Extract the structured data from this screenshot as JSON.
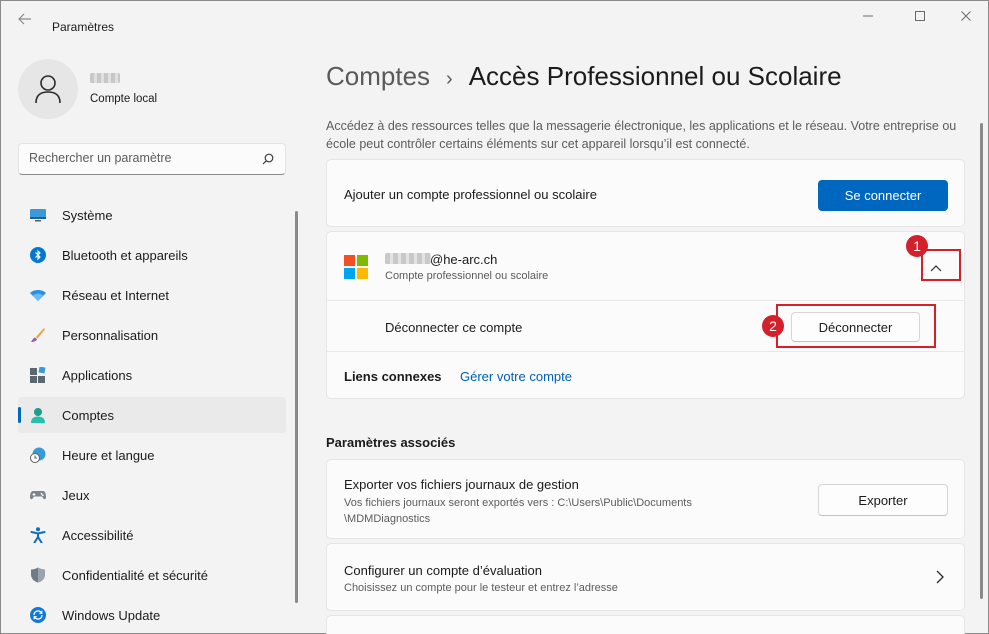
{
  "window": {
    "title": "Paramètres",
    "back_icon": "arrow-left-icon",
    "controls": [
      "minimize-icon",
      "maximize-icon",
      "close-icon"
    ]
  },
  "user": {
    "account_type": "Compte local"
  },
  "search": {
    "placeholder": "Rechercher un paramètre"
  },
  "sidebar": {
    "items": [
      {
        "label": "Système",
        "icon": "monitor-icon"
      },
      {
        "label": "Bluetooth et appareils",
        "icon": "bluetooth-icon"
      },
      {
        "label": "Réseau et Internet",
        "icon": "wifi-icon"
      },
      {
        "label": "Personnalisation",
        "icon": "brush-icon"
      },
      {
        "label": "Applications",
        "icon": "apps-icon"
      },
      {
        "label": "Comptes",
        "icon": "person-icon",
        "active": true
      },
      {
        "label": "Heure et langue",
        "icon": "clock-globe-icon"
      },
      {
        "label": "Jeux",
        "icon": "gamepad-icon"
      },
      {
        "label": "Accessibilité",
        "icon": "accessibility-icon"
      },
      {
        "label": "Confidentialité et sécurité",
        "icon": "shield-icon"
      },
      {
        "label": "Windows Update",
        "icon": "update-icon"
      }
    ]
  },
  "header": {
    "parent": "Comptes",
    "separator": "›",
    "current": "Accès Professionnel ou Scolaire"
  },
  "description": "Accédez à des ressources telles que la messagerie électronique, les applications et le réseau. Votre entreprise ou école peut contrôler certains éléments sur cet appareil lorsqu’il est connecté.",
  "add_account": {
    "label": "Ajouter un compte professionnel ou scolaire",
    "button": "Se connecter"
  },
  "account": {
    "email_domain": "@he-arc.ch",
    "type": "Compte professionnel ou scolaire",
    "disconnect_label": "Déconnecter ce compte",
    "disconnect_button": "Déconnecter",
    "links_label": "Liens connexes",
    "manage_link": "Gérer votre compte"
  },
  "related": {
    "title": "Paramètres associés",
    "export": {
      "title": "Exporter vos fichiers journaux de gestion",
      "desc_line1": "Vos fichiers journaux seront exportés vers : C:\\Users\\Public\\Documents",
      "desc_line2": "\\MDMDiagnostics",
      "button": "Exporter"
    },
    "evaluation": {
      "title": "Configurer un compte d’évaluation",
      "desc": "Choisissez un compte pour le testeur et entrez l’adresse"
    }
  },
  "annotations": {
    "badge1": "1",
    "badge2": "2",
    "color": "#d3202a"
  },
  "colors": {
    "accent": "#0067c0",
    "link": "#005fb8"
  }
}
